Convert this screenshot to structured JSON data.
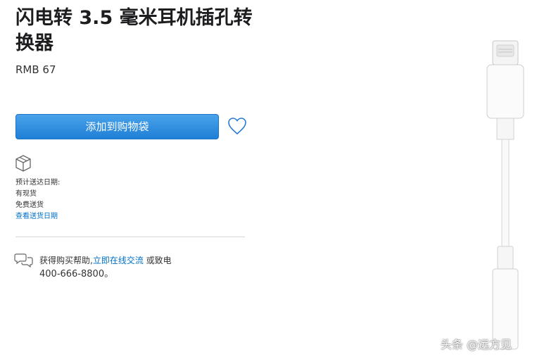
{
  "product": {
    "title": "闪电转 3.5 毫米耳机插孔转换器",
    "price": "RMB 67",
    "add_to_bag_label": "添加到购物袋",
    "favorite_icon": "heart-icon",
    "image_icon": "lightning-to-headphone-adapter"
  },
  "shipping": {
    "icon": "box-icon",
    "estimated_label": "预计送达日期:",
    "availability": "有现货",
    "free_shipping": "免费送货",
    "view_link": "查看送货日期"
  },
  "help": {
    "icon": "chat-bubbles-icon",
    "prefix": "获得购买帮助,",
    "chat_link": "立即在线交流",
    "or_call": " 或致电",
    "phone": "400-666-8800。"
  },
  "watermark": "头条 @远方见",
  "colors": {
    "button_top": "#4aa3ea",
    "button_bottom": "#1f7fd6",
    "link": "#0070c9",
    "text": "#1d1d1f"
  }
}
